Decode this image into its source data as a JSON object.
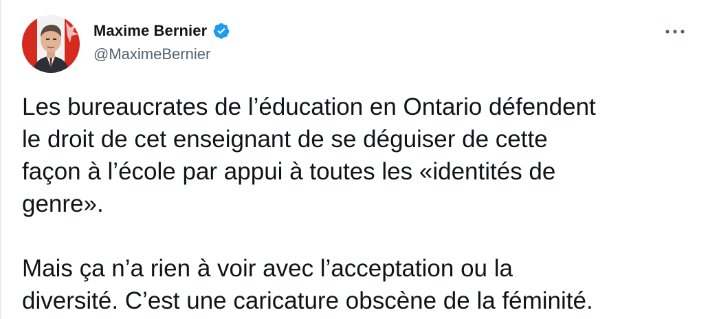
{
  "author": {
    "display_name": "Maxime Bernier",
    "handle": "@MaximeBernier",
    "verified": true
  },
  "tweet": {
    "paragraph_1": "Les bureaucrates de l’éducation en Ontario défendent\nle droit de cet enseignant de se déguiser de cette\nfaçon à l’école par appui à toutes les «identités de\ngenre».",
    "paragraph_2": "Mais ça n’a rien à voir avec l’acceptation ou la\ndiversité. C’est une caricature obscène de la féminité."
  },
  "icons": {
    "verified": "verified-badge-icon",
    "more": "more-options-icon"
  },
  "colors": {
    "verified_blue": "#1d9bf0",
    "text_primary": "#0f1419",
    "text_secondary": "#536471"
  }
}
